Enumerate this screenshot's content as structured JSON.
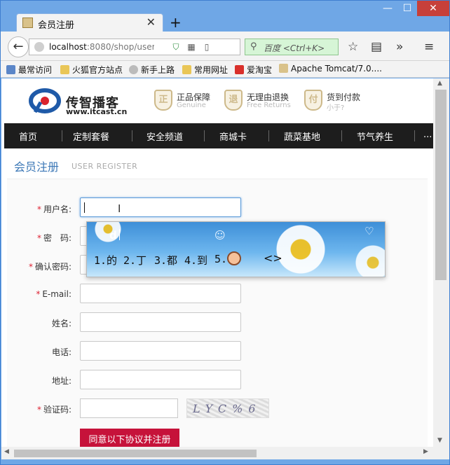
{
  "browser": {
    "tab_title": "会员注册",
    "tab_close": "✕",
    "new_tab": "+",
    "window_controls": {
      "minimize": "—",
      "maximize": "☐",
      "close": "✕"
    },
    "url_host": "localhost",
    "url_path": ":8080/shop/user",
    "search_placeholder": "百度 <Ctrl+K>",
    "bookmarks": [
      "最常访问",
      "火狐官方站点",
      "新手上路",
      "常用网址",
      "爱淘宝",
      "Apache Tomcat/7.0...."
    ]
  },
  "site": {
    "logo_name": "传智播客",
    "logo_url": "www.itcast.cn",
    "promos": [
      {
        "icon": "正",
        "title": "正品保障",
        "subtitle": "Genuine"
      },
      {
        "icon": "退",
        "title": "无理由退换",
        "subtitle": "Free Returns"
      },
      {
        "icon": "付",
        "title": "货到付款",
        "subtitle": "小于?"
      }
    ],
    "nav": [
      "首页",
      "定制套餐",
      "安全频道",
      "商城卡",
      "蔬菜基地",
      "节气养生",
      "..."
    ]
  },
  "register": {
    "title": "会员注册",
    "subtitle": "USER REGISTER",
    "fields": {
      "username": {
        "label": "用户名:",
        "required": true,
        "value": ""
      },
      "password": {
        "label": "密　码:",
        "required": true
      },
      "confirm": {
        "label": "确认密码:",
        "required": true
      },
      "email": {
        "label": "E-mail:",
        "required": true
      },
      "name": {
        "label": "姓名:",
        "required": false
      },
      "phone": {
        "label": "电话:",
        "required": false
      },
      "address": {
        "label": "地址:",
        "required": false
      },
      "captcha": {
        "label": "验证码:",
        "required": true
      }
    },
    "captcha_image_text": "LYC%6",
    "submit": "同意以下协议并注册"
  },
  "ime": {
    "composition": "d",
    "candidates": [
      "1.的",
      "2.丁",
      "3.都",
      "4.到",
      "5."
    ],
    "nav_arrows": "<>"
  }
}
